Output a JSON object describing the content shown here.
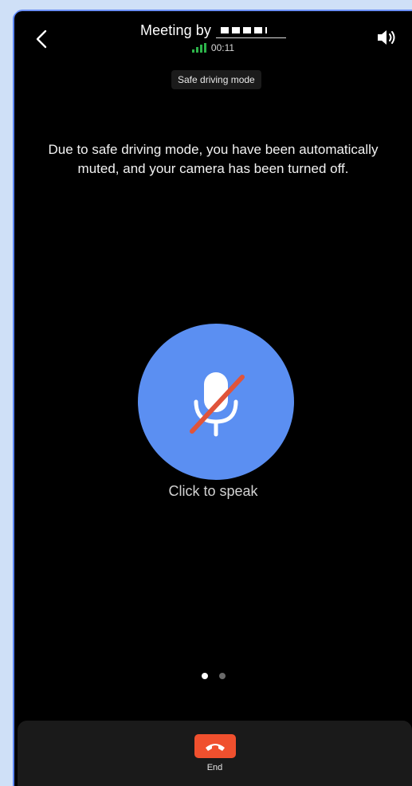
{
  "header": {
    "back_icon": "chevron-left-icon",
    "meeting_title": "Meeting by",
    "meeting_host_redacted": "redacted",
    "signal_icon": "signal-strength-icon",
    "duration": "00:11",
    "speaker_icon": "speaker-icon",
    "mode_badge": "Safe driving mode"
  },
  "main": {
    "message": "Due to safe driving mode, you have been automatically muted, and your camera has been turned off.",
    "mic_icon": "mic-off-icon",
    "mic_color": "#5b8ff2",
    "mic_label": "Click to speak"
  },
  "pager": {
    "count": 2,
    "active_index": 0
  },
  "footer": {
    "end_icon": "phone-hangup-icon",
    "end_color": "#f0502e",
    "end_label": "End"
  }
}
